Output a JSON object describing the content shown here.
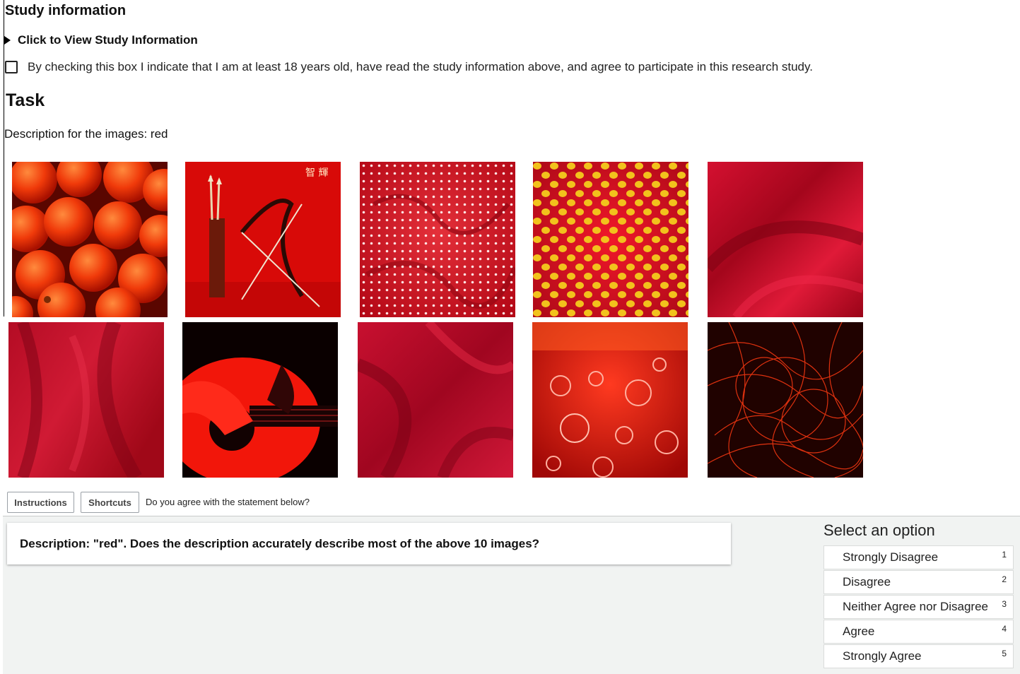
{
  "study": {
    "title": "Study information",
    "details_label": "Click to View Study Information",
    "consent_text": "By checking this box I indicate that I am at least 18 years old, have read the study information above, and agree to participate in this research study.",
    "consent_checked": false
  },
  "task": {
    "title": "Task",
    "description_line": "Description for the images: red"
  },
  "images": [
    {
      "name": "image-tangerines",
      "subject": "pile of red tangerines"
    },
    {
      "name": "image-bow-arrows",
      "subject": "bow, arrows and quiver on red cloth",
      "caption": "智 輝"
    },
    {
      "name": "image-white-dots",
      "subject": "red fabric with small white polka dots"
    },
    {
      "name": "image-yellow-dots",
      "subject": "red fabric with yellow polka dots"
    },
    {
      "name": "image-silk-1",
      "subject": "draped red silk"
    },
    {
      "name": "image-silk-2",
      "subject": "draped red silk"
    },
    {
      "name": "image-guitar",
      "subject": "hands playing an acoustic guitar, red tint"
    },
    {
      "name": "image-silk-3",
      "subject": "draped red silk"
    },
    {
      "name": "image-bubbles",
      "subject": "red liquid with bubbles"
    },
    {
      "name": "image-light-trails",
      "subject": "red light trails on black"
    }
  ],
  "toolbar": {
    "instructions_label": "Instructions",
    "shortcuts_label": "Shortcuts",
    "prompt": "Do you agree with the statement below?"
  },
  "question": {
    "text": "Description: \"red\". Does the description accurately describe most of the above 10 images?"
  },
  "options": {
    "title": "Select an option",
    "items": [
      {
        "label": "Strongly Disagree",
        "key": "1"
      },
      {
        "label": "Disagree",
        "key": "2"
      },
      {
        "label": "Neither Agree nor Disagree",
        "key": "3"
      },
      {
        "label": "Agree",
        "key": "4"
      },
      {
        "label": "Strongly Agree",
        "key": "5"
      }
    ]
  },
  "colors": {
    "panel_bg": "#f1f3f2",
    "red": "#d4001a"
  }
}
